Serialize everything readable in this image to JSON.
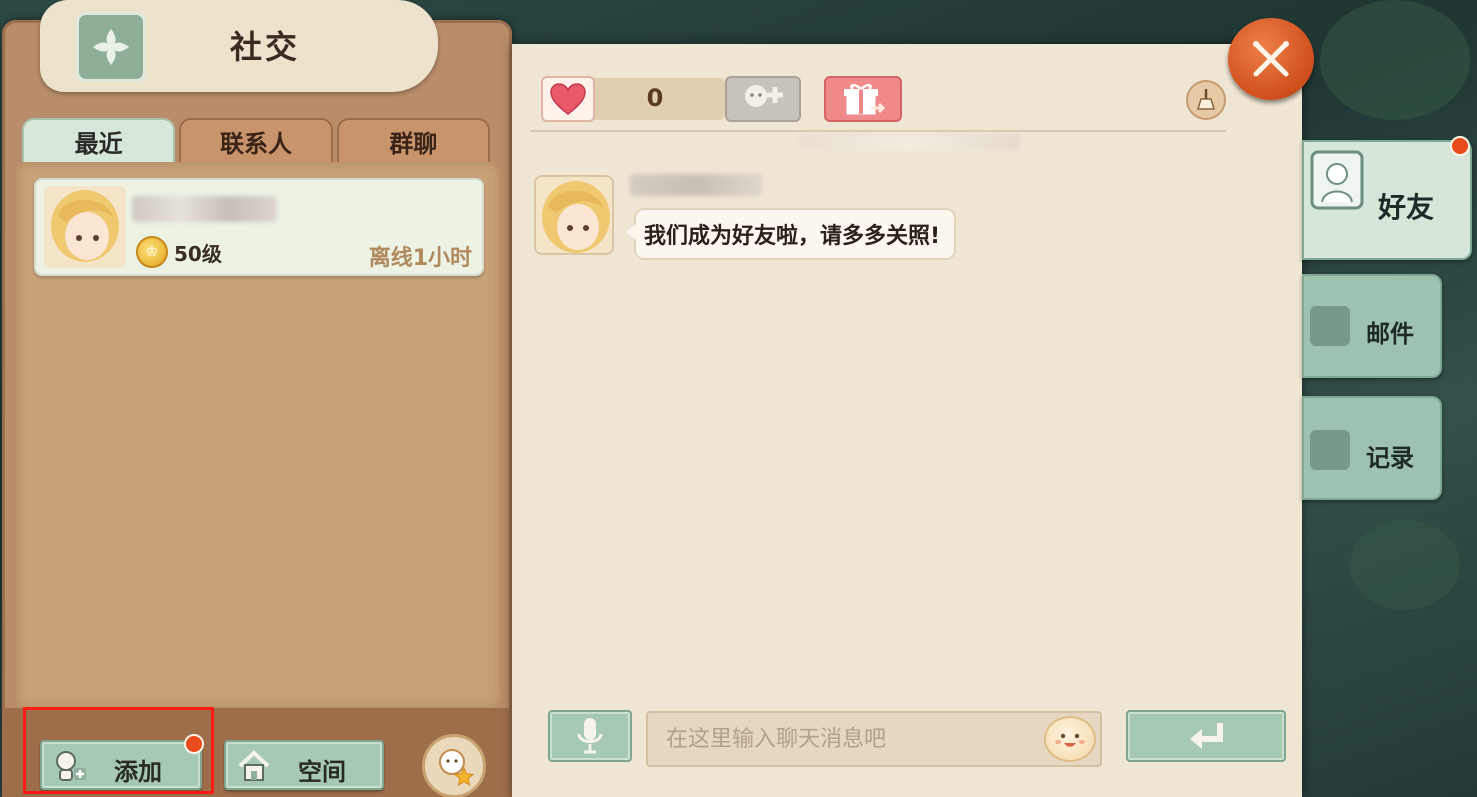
{
  "header": {
    "title": "社交"
  },
  "tabs": [
    {
      "label": "最近",
      "active": true
    },
    {
      "label": "联系人",
      "active": false
    },
    {
      "label": "群聊",
      "active": false
    }
  ],
  "friend_list": [
    {
      "name": "",
      "level": "50级",
      "status": "离线1小时"
    }
  ],
  "left_bottom": {
    "add_label": "添加",
    "space_label": "空间"
  },
  "chat": {
    "heart_count": "0",
    "messages": [
      {
        "sender": "",
        "text": "我们成为好友啦，请多多关照!"
      }
    ],
    "input_placeholder": "在这里输入聊天消息吧",
    "input_value": ""
  },
  "side_tabs": [
    {
      "label": "好友",
      "active": true,
      "badge": true
    },
    {
      "label": "邮件",
      "active": false,
      "badge": false
    },
    {
      "label": "记录",
      "active": false,
      "badge": false
    }
  ],
  "colors": {
    "badge": "#e84b1c",
    "accent_green": "#a6c9b3",
    "close": "#cf4f1c",
    "highlight": "#ff1b12"
  },
  "icons": {
    "emblem": "fleur-icon",
    "heart": "heart-icon",
    "add_friend": "add-friend-icon",
    "gift": "gift-icon",
    "sweep": "broom-icon",
    "mic": "microphone-icon",
    "emoji": "smiley-icon",
    "send": "enter-icon",
    "close": "close-icon"
  }
}
